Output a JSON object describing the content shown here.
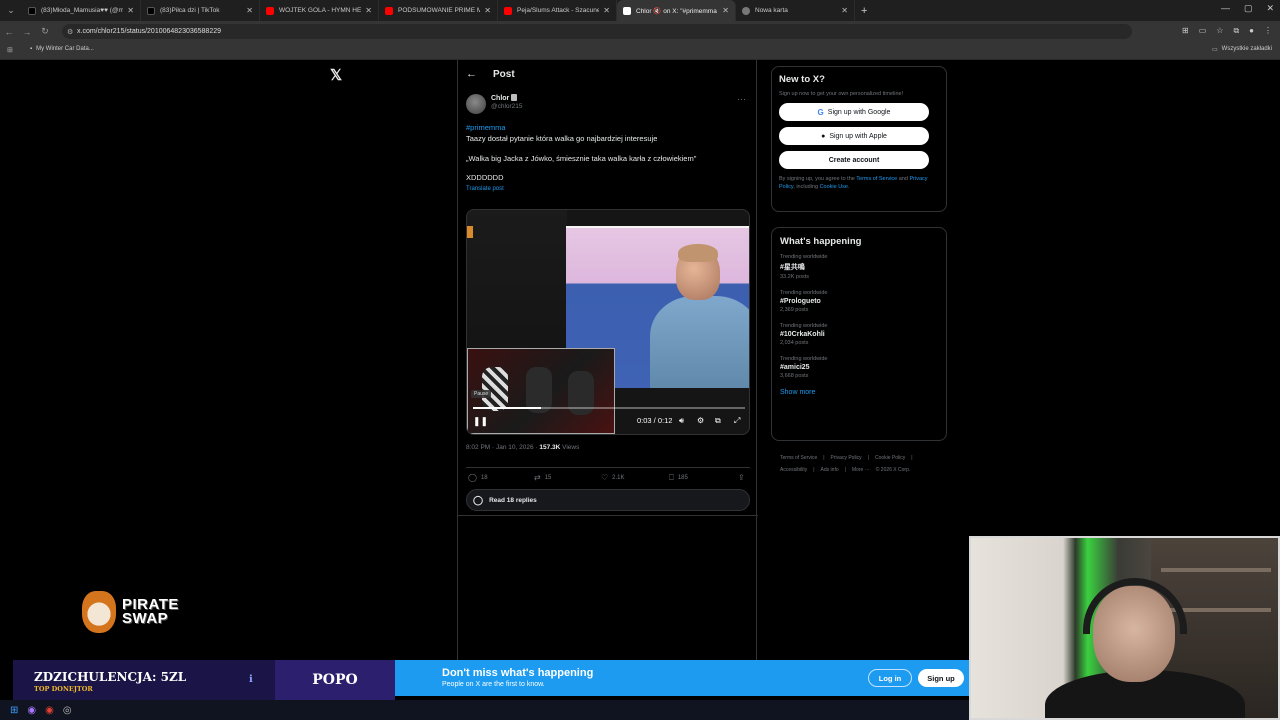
{
  "browser": {
    "tabs": [
      {
        "title": "(83)Młoda_Mamusia♥♥ (@ma",
        "color": "#000000",
        "active": false
      },
      {
        "title": "(83)Piłca dzi | TikTok",
        "color": "#000000",
        "active": false
      },
      {
        "title": "WOJTEK GOLA - HYMN HETER",
        "color": "#ff0000",
        "active": false
      },
      {
        "title": "PODSUMOWANIE PRIME MMA",
        "color": "#ff0000",
        "active": false
      },
      {
        "title": "Peja/Slums Attack - Szacunek",
        "color": "#ff0000",
        "active": false
      },
      {
        "title": "Chlor 🔇 on X: \"#primemma",
        "color": "#ffffff",
        "active": true
      },
      {
        "title": "Nowa karta",
        "color": "#888888",
        "active": false
      }
    ],
    "url": "x.com/chlor215/status/2010064823036588229",
    "bookmark": "My Winter Car Data...",
    "all_bookmarks": "Wszystkie zakładki"
  },
  "post": {
    "header_title": "Post",
    "author_name": "Chlor",
    "author_handle": "@chlor215",
    "hashtag": "#primemma",
    "line1": "Taazy dostał pytanie która walka go najbardziej interesuje",
    "line2": "„Walka big Jacka z Jówko, śmiesznie taka walka karła z człowiekiem\"",
    "line3": "XDDDDDD",
    "translate": "Translate post",
    "video": {
      "pause_tooltip": "Pause",
      "time": "0:03 / 0:12",
      "progress": 0.25
    },
    "timestamp": "8:02 PM · Jan 10, 2026 · ",
    "views_count": "157.3K",
    "views_label": " Views",
    "actions": {
      "replies": "18",
      "reposts": "15",
      "likes": "2.1K",
      "bookmarks": "185"
    },
    "read_replies": "Read 18 replies"
  },
  "sidebar": {
    "new_title": "New to X?",
    "new_sub": "Sign up now to get your own personalized timeline!",
    "google_btn": "Sign up with Google",
    "apple_btn": "Sign up with Apple",
    "create_btn": "Create account",
    "terms_pre": "By signing up, you agree to the ",
    "terms_link": "Terms of Service",
    "terms_and": " and ",
    "privacy_link": "Privacy Policy",
    "terms_incl": ", including ",
    "cookie_link": "Cookie Use",
    "terms_end": ".",
    "happening_title": "What's happening",
    "trends": [
      {
        "label": "Trending worldwide",
        "name": "#星共鳴",
        "count": "33.2K posts"
      },
      {
        "label": "Trending worldwide",
        "name": "#Prologueto",
        "count": "2,369 posts"
      },
      {
        "label": "Trending worldwide",
        "name": "#10CrkaKohli",
        "count": "2,034 posts"
      },
      {
        "label": "Trending worldwide",
        "name": "#amici25",
        "count": "3,668 posts"
      }
    ],
    "show_more": "Show more",
    "footer": [
      "Terms of Service",
      "|",
      "Privacy Policy",
      "|",
      "Cookie Policy",
      "|",
      "Accessibility",
      "|",
      "Ads info",
      "|",
      "More ···",
      "© 2026 X Corp."
    ]
  },
  "overlay": {
    "pirate_line1": "PIRATE",
    "pirate_line2": "SWAP",
    "donor_main": "ZDZICHULENCJA: 5ZL",
    "donor_sub": "TOP DONEJTOR",
    "popo": "POPO"
  },
  "banner": {
    "headline": "Don't miss what's happening",
    "sub": "People on X are the first to know.",
    "login": "Log in",
    "signup": "Sign up"
  }
}
